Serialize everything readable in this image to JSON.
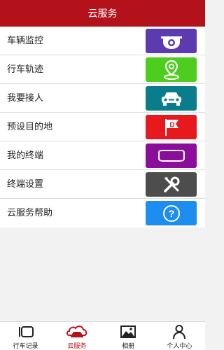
{
  "header": {
    "title": "云服务"
  },
  "menu": [
    {
      "label": "车辆监控",
      "icon": "camera-monitor-icon",
      "color": "#5c3bb0"
    },
    {
      "label": "行车轨迹",
      "icon": "map-pin-icon",
      "color": "#4dce1f"
    },
    {
      "label": "我要接人",
      "icon": "car-front-icon",
      "color": "#0a7d8c"
    },
    {
      "label": "预设目的地",
      "icon": "destination-flag-icon",
      "color": "#e8181f"
    },
    {
      "label": "我的终端",
      "icon": "rearview-mirror-icon",
      "color": "#8a0e9a"
    },
    {
      "label": "终端设置",
      "icon": "tools-icon",
      "color": "#4d4d4d"
    },
    {
      "label": "云服务帮助",
      "icon": "help-icon",
      "color": "#1e8df0"
    }
  ],
  "flag_letter": "D",
  "help_symbol": "?",
  "tabs": [
    {
      "label": "行车记录",
      "icon": "dashcam-icon",
      "active": false
    },
    {
      "label": "云服务",
      "icon": "cloud-car-icon",
      "active": true
    },
    {
      "label": "相册",
      "icon": "photo-album-icon",
      "active": false
    },
    {
      "label": "个人中心",
      "icon": "person-icon",
      "active": false
    }
  ],
  "colors": {
    "header": "#b3121b",
    "active_tab": "#b3121b"
  }
}
